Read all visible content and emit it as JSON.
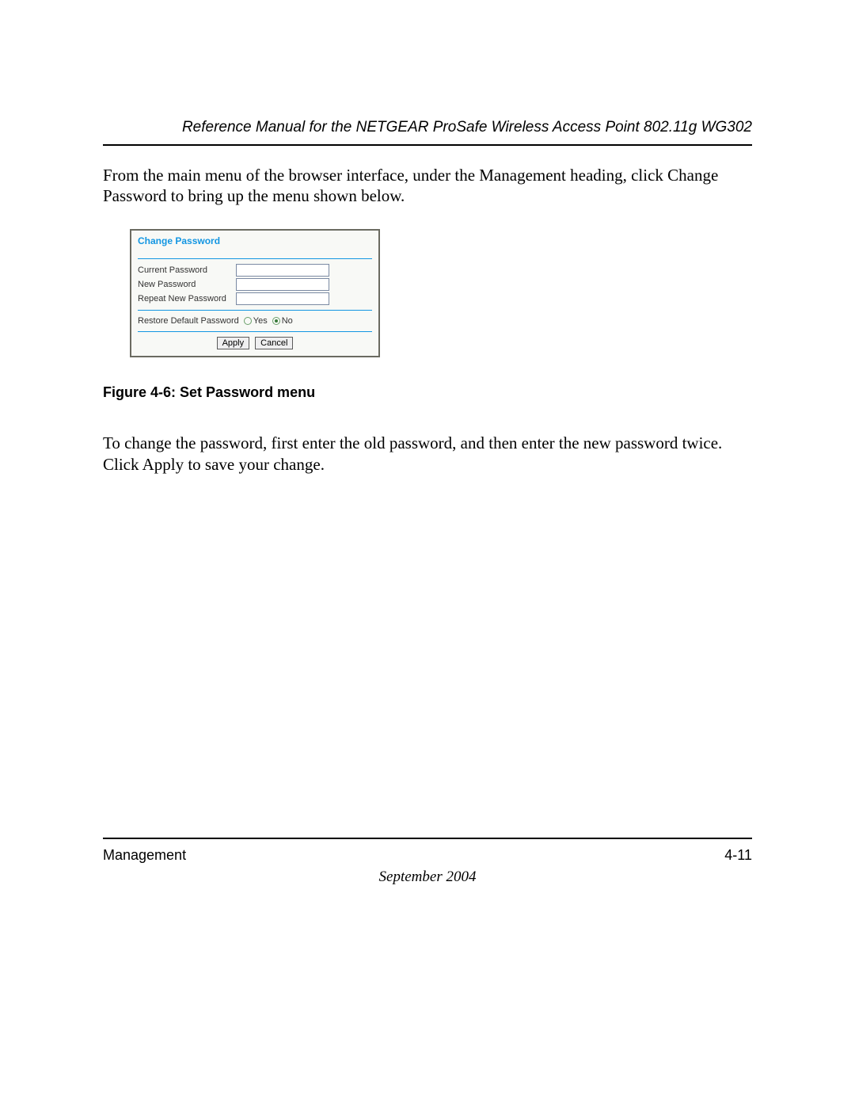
{
  "header": {
    "running_title": "Reference Manual for the NETGEAR ProSafe Wireless Access Point 802.11g WG302"
  },
  "para1": "From the main menu of the browser interface, under the Management heading, click Change Password to bring up the menu shown below.",
  "panel": {
    "title": "Change Password",
    "current_label": "Current Password",
    "new_label": "New Password",
    "repeat_label": "Repeat New Password",
    "restore_label": "Restore Default Password",
    "yes_label": "Yes",
    "no_label": "No",
    "restore_selected": "No",
    "apply_btn": "Apply",
    "cancel_btn": "Cancel"
  },
  "caption": "Figure 4-6:  Set Password menu",
  "para2": "To change the password, first enter the old password, and then enter the new password twice. Click Apply to save your change.",
  "footer": {
    "section": "Management",
    "page_number": "4-11",
    "date": "September 2004"
  }
}
